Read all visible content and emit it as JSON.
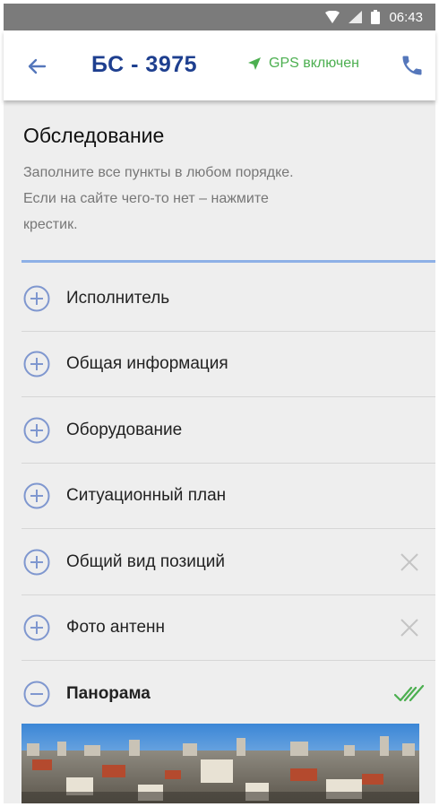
{
  "status_bar": {
    "time": "06:43",
    "icons": [
      "wifi-icon",
      "signal-icon",
      "battery-icon"
    ]
  },
  "app_bar": {
    "title": "БС - 3975",
    "gps_label": "GPS включен",
    "back_icon": "arrow-left-icon",
    "phone_icon": "phone-icon"
  },
  "section": {
    "title": "Обследование",
    "description_lines": [
      "Заполните все пункты в любом порядке.",
      "Если на сайте чего-то нет – нажмите",
      "крестик."
    ]
  },
  "items": [
    {
      "label": "Исполнитель",
      "state": "collapsed",
      "trailing": ""
    },
    {
      "label": "Общая информация",
      "state": "collapsed",
      "trailing": ""
    },
    {
      "label": "Оборудование",
      "state": "collapsed",
      "trailing": ""
    },
    {
      "label": "Ситуационный план",
      "state": "collapsed",
      "trailing": ""
    },
    {
      "label": "Общий вид позиций",
      "state": "collapsed",
      "trailing": "close-icon"
    },
    {
      "label": "Фото антенн",
      "state": "collapsed",
      "trailing": "close-icon"
    },
    {
      "label": "Панорама",
      "state": "expanded",
      "trailing": "double-check-icon"
    }
  ],
  "colors": {
    "accent": "#1e3f8f",
    "icon_blue": "#7f97cf",
    "gps_green": "#4caf50",
    "check_green": "#4caf50",
    "status_bar": "#7b7b7b",
    "background": "#eeeeee"
  }
}
